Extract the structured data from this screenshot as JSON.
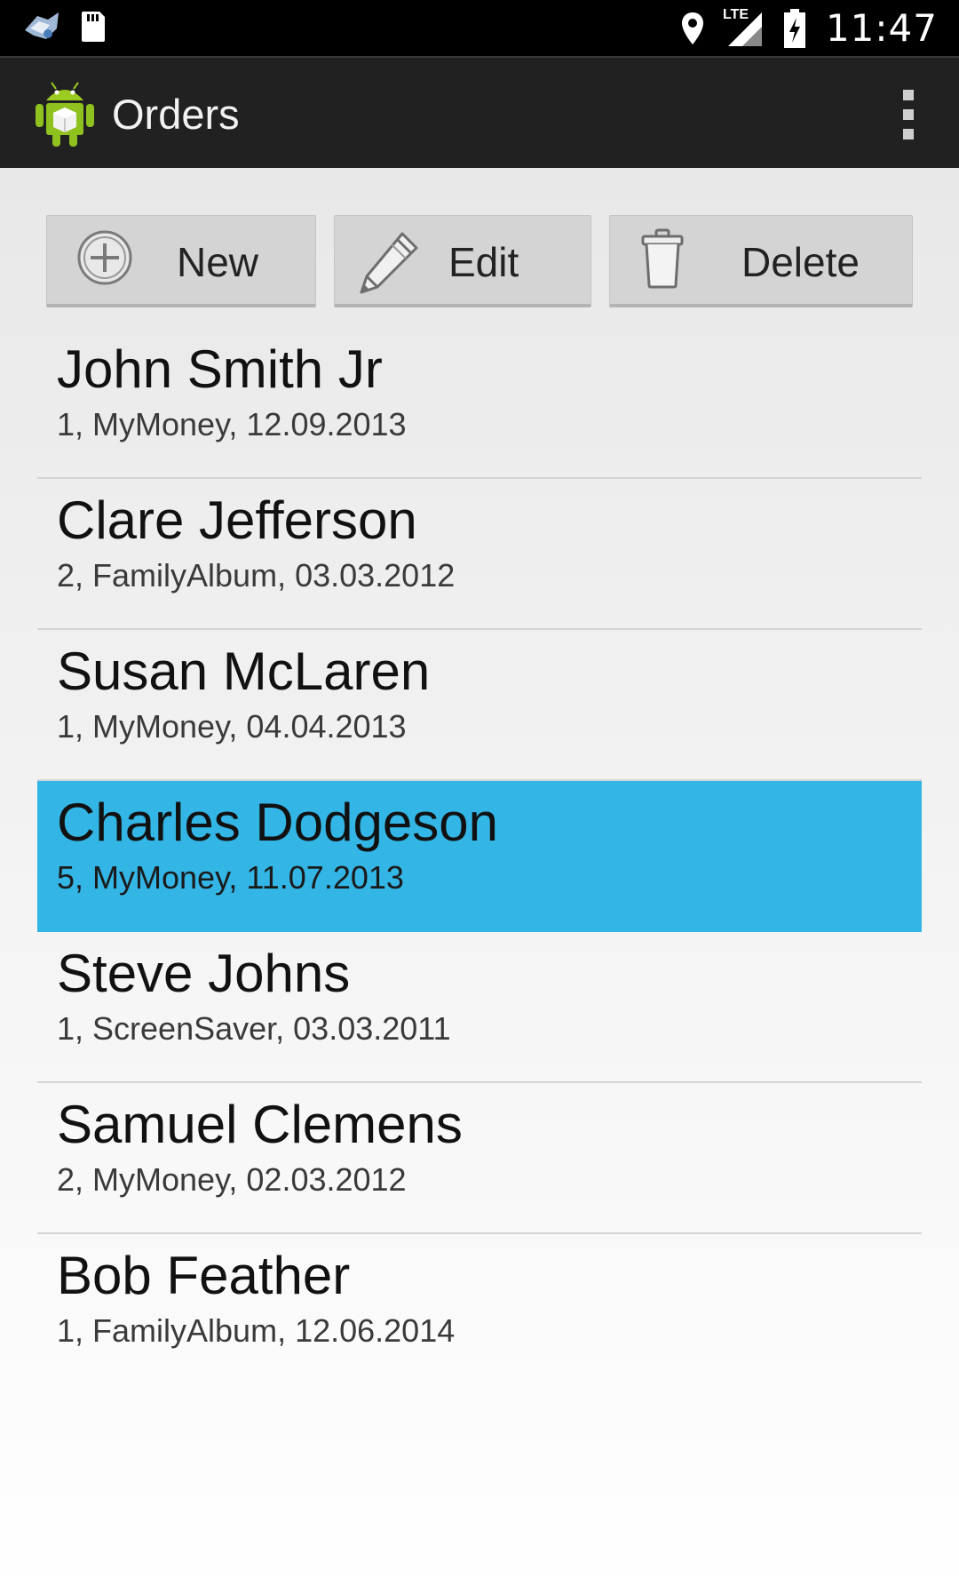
{
  "status_bar": {
    "time": "11:47",
    "network_label": "LTE",
    "icons": [
      "app-notification-icon",
      "sd-card-icon",
      "location-icon",
      "signal-icon",
      "battery-charging-icon"
    ]
  },
  "action_bar": {
    "title": "Orders",
    "app_icon": "android-robot-icon",
    "overflow_icon": "overflow-menu-icon"
  },
  "toolbar": {
    "new_label": "New",
    "edit_label": "Edit",
    "delete_label": "Delete",
    "new_icon": "plus-circle-icon",
    "edit_icon": "pencil-icon",
    "delete_icon": "trash-icon"
  },
  "orders": [
    {
      "name": "John Smith Jr",
      "details": "1, MyMoney, 12.09.2013",
      "selected": false
    },
    {
      "name": "Clare Jefferson",
      "details": "2, FamilyAlbum, 03.03.2012",
      "selected": false
    },
    {
      "name": "Susan McLaren",
      "details": "1, MyMoney, 04.04.2013",
      "selected": false
    },
    {
      "name": "Charles Dodgeson",
      "details": "5, MyMoney, 11.07.2013",
      "selected": true
    },
    {
      "name": "Steve Johns",
      "details": "1, ScreenSaver, 03.03.2011",
      "selected": false
    },
    {
      "name": "Samuel Clemens",
      "details": "2, MyMoney, 02.03.2012",
      "selected": false
    },
    {
      "name": "Bob Feather",
      "details": "1, FamilyAlbum, 12.06.2014",
      "selected": false
    }
  ],
  "colors": {
    "selection": "#33b5e5",
    "action_bar": "#212121",
    "status_bar": "#000000"
  }
}
